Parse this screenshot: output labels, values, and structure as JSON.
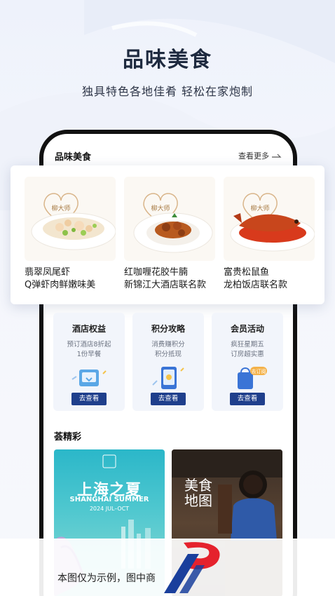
{
  "hero": {
    "title": "品味美食",
    "subtitle": "独具特色各地佳肴 轻松在家炮制"
  },
  "panel": {
    "title": "品味美食",
    "more_label": "查看更多"
  },
  "foods": [
    {
      "name": "翡翠凤尾虾",
      "desc": "Q弹虾肉鲜嫩味美",
      "badge": "柳大师"
    },
    {
      "name": "红咖喱花胶牛腩",
      "desc": "新锦江大酒店联名款",
      "badge": "柳大师"
    },
    {
      "name": "富贵松鼠鱼",
      "desc": "龙柏饭店联名款",
      "badge": "柳大师"
    }
  ],
  "benefits": [
    {
      "title": "酒店权益",
      "line1": "预订酒店8折起",
      "line2": "1份早餐",
      "button": "去查看"
    },
    {
      "title": "积分攻略",
      "line1": "消费赚积分",
      "line2": "积分抵现",
      "button": "去查看"
    },
    {
      "title": "会员活动",
      "line1": "疯狂星期五",
      "line2": "订房超实惠",
      "button": "去查看",
      "tag": "去订阅"
    }
  ],
  "section": {
    "title": "荟精彩"
  },
  "promos": {
    "left": {
      "title": "上海之夏",
      "en": "SHANGHAI SUMMER",
      "date": "2024 JUL–OCT"
    },
    "right": {
      "title_a": "美食",
      "title_b": "地图"
    }
  },
  "disclaimer": "本图仅为示例，图中商",
  "colors": {
    "accent": "#1f3f8c",
    "brand_red": "#e5222d",
    "brand_blue": "#1a3f9c"
  }
}
